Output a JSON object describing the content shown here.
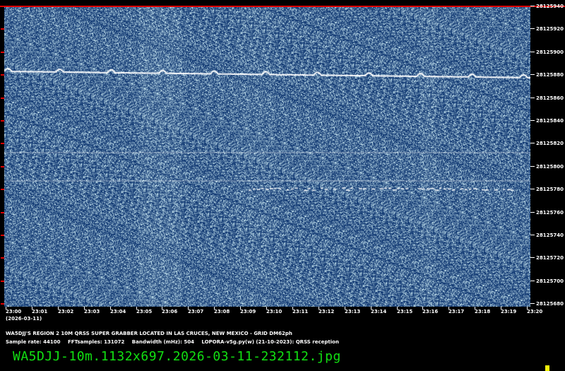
{
  "y_axis": {
    "labels": [
      "28125940",
      "28125920",
      "28125900",
      "28125880",
      "28125860",
      "28125840",
      "28125820",
      "28125800",
      "28125780",
      "28125760",
      "28125740",
      "28125720",
      "28125700",
      "28125680"
    ]
  },
  "x_axis": {
    "labels": [
      "23:00",
      "23:01",
      "23:02",
      "23:03",
      "23:04",
      "23:05",
      "23:06",
      "23:07",
      "23:08",
      "23:09",
      "23:10",
      "23:11",
      "23:12",
      "23:13",
      "23:14",
      "23:15",
      "23:16",
      "23:17",
      "23:18",
      "23:19",
      "23:20"
    ],
    "date": "(2026-03-11)"
  },
  "footer": {
    "station": "WA5DJJ'S REGION 2 10M QRSS SUPER GRABBER LOCATED IN LAS CRUCES, NEW MEXICO - GRID DM62ph",
    "sample_rate": "Sample rate: 44100",
    "fft_samples": "FFTsamples: 131072",
    "bandwidth": "Bandwidth (mHz): 504",
    "software": "LOPORA-v5g.py(w) (21-10-2023): QRSS reception",
    "filename": "WA5DJJ-10m.1132x697.2026-03-11-232112.jpg"
  },
  "colors": {
    "background": "#000000",
    "waterfall": "#1a4f86",
    "signal": "#ffffff",
    "border": "#dd0000",
    "filename": "#12e012",
    "marker": "#f2f20a"
  }
}
